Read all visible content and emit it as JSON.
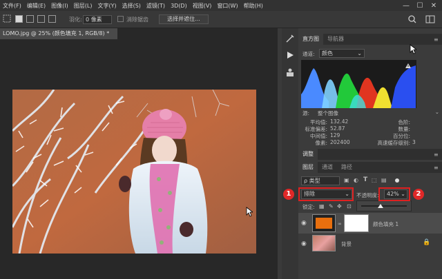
{
  "menubar": {
    "items": [
      "文件(F)",
      "编辑(E)",
      "图像(I)",
      "图层(L)",
      "文字(Y)",
      "选择(S)",
      "滤镜(T)",
      "3D(D)",
      "视图(V)",
      "窗口(W)",
      "帮助(H)"
    ],
    "window_controls": [
      "—",
      "☐",
      "✕"
    ]
  },
  "options": {
    "feather_label": "羽化:",
    "feather_value": "0 像素",
    "antialias_label": "消除锯齿",
    "select_mask_label": "选择并遮住..."
  },
  "document": {
    "tab_title": "LOMO.jpg @ 25% (颜色填充 1, RGB/8) *",
    "close": "×"
  },
  "histogram": {
    "tabs": [
      "直方图",
      "导航器"
    ],
    "channel_label": "通道:",
    "channel_value": "颜色",
    "source_label": "源:",
    "source_value": "整个图像",
    "stats_left": [
      {
        "label": "平均值:",
        "value": "132.42"
      },
      {
        "label": "标准偏差:",
        "value": "52.87"
      },
      {
        "label": "中间值:",
        "value": "129"
      },
      {
        "label": "像素:",
        "value": "202400"
      }
    ],
    "stats_right": [
      {
        "label": "色阶:",
        "value": ""
      },
      {
        "label": "数量:",
        "value": ""
      },
      {
        "label": "百分位:",
        "value": ""
      },
      {
        "label": "高速缓存级别:",
        "value": "3"
      }
    ]
  },
  "adjustments": {
    "tab": "调整"
  },
  "layers": {
    "tabs": [
      "图层",
      "通道",
      "路径"
    ],
    "filter_label": "ρ 类型",
    "blend_mode": "排除",
    "opacity_label": "不透明度:",
    "opacity_value": "42%",
    "opacity_fraction": 0.42,
    "lock_label": "锁定:",
    "items": [
      {
        "name": "颜色填充 1",
        "visible": true,
        "thumb_color": "#e86f0e"
      },
      {
        "name": "背景",
        "visible": true,
        "locked": true
      }
    ]
  },
  "annotations": [
    "1",
    "2"
  ],
  "colors": {
    "accent_red": "#e02020",
    "fill_orange": "#e86f0e",
    "panel_bg": "#3b3b3b"
  }
}
